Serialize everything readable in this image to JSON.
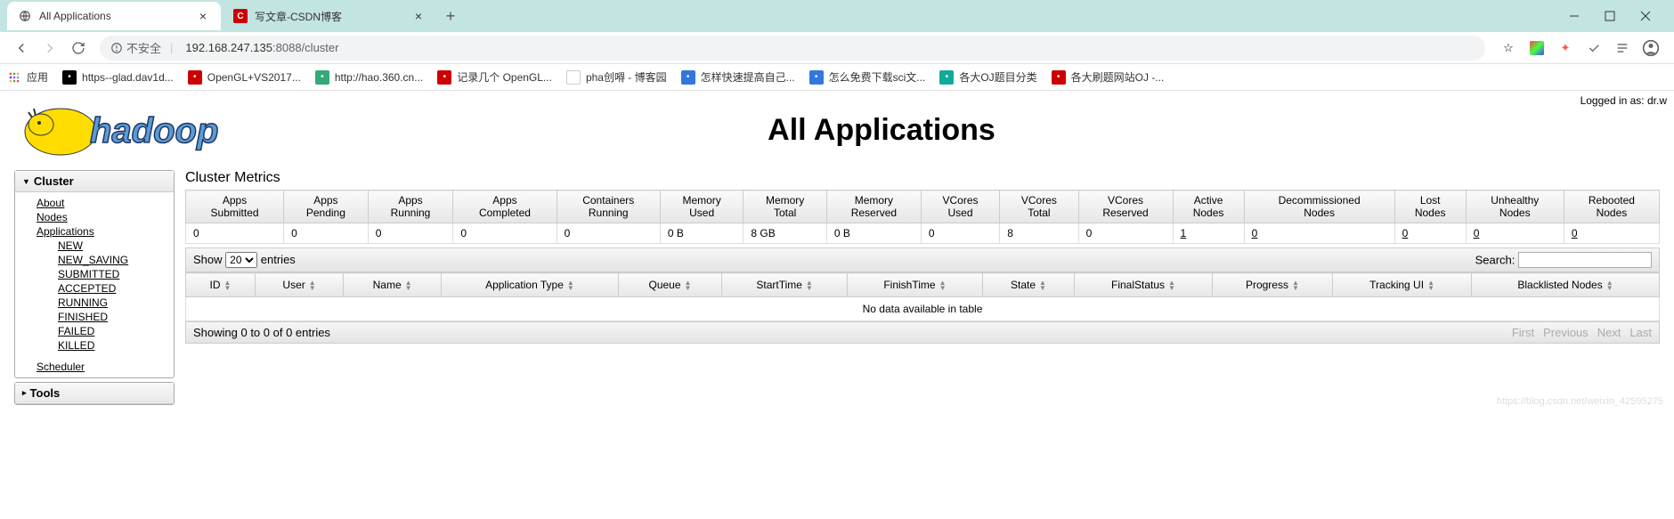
{
  "browser": {
    "tabs": [
      {
        "title": "All Applications",
        "active": true
      },
      {
        "title": "写文章-CSDN博客",
        "active": false
      }
    ],
    "insecure_label": "不安全",
    "url_host": "192.168.247.135",
    "url_port": ":8088",
    "url_path": "/cluster",
    "bookmarks_apps_label": "应用",
    "bookmarks": [
      {
        "label": "https--glad.dav1d...",
        "bg": "#000"
      },
      {
        "label": "OpenGL+VS2017...",
        "bg": "#c00"
      },
      {
        "label": "http://hao.360.cn...",
        "bg": "#3a7"
      },
      {
        "label": "记录几个 OpenGL...",
        "bg": "#c00"
      },
      {
        "label": "pha创嘚 - 博客园",
        "bg": "#fff"
      },
      {
        "label": "怎样快速提高自己...",
        "bg": "#37d"
      },
      {
        "label": "怎么免费下载sci文...",
        "bg": "#37d"
      },
      {
        "label": "各大OJ题目分类",
        "bg": "#1a9"
      },
      {
        "label": "各大刷题网站OJ -...",
        "bg": "#c00"
      }
    ]
  },
  "page": {
    "title": "All Applications",
    "logged_in_prefix": "Logged in as: ",
    "logged_in_user": "dr.w",
    "watermark": "https://blog.csdn.net/weixin_42595275"
  },
  "sidebar": {
    "cluster_header": "Cluster",
    "tools_header": "Tools",
    "links": {
      "about": "About",
      "nodes": "Nodes",
      "applications": "Applications",
      "scheduler": "Scheduler"
    },
    "app_states": [
      "NEW",
      "NEW_SAVING",
      "SUBMITTED",
      "ACCEPTED",
      "RUNNING",
      "FINISHED",
      "FAILED",
      "KILLED"
    ]
  },
  "metrics": {
    "section_title": "Cluster Metrics",
    "headers": [
      "Apps Submitted",
      "Apps Pending",
      "Apps Running",
      "Apps Completed",
      "Containers Running",
      "Memory Used",
      "Memory Total",
      "Memory Reserved",
      "VCores Used",
      "VCores Total",
      "VCores Reserved",
      "Active Nodes",
      "Decommissioned Nodes",
      "Lost Nodes",
      "Unhealthy Nodes",
      "Rebooted Nodes"
    ],
    "values": [
      "0",
      "0",
      "0",
      "0",
      "0",
      "0 B",
      "8 GB",
      "0 B",
      "0",
      "8",
      "0",
      "1",
      "0",
      "0",
      "0",
      "0"
    ],
    "linked_indices": [
      11,
      12,
      13,
      14,
      15
    ]
  },
  "datatable": {
    "show_label": "Show",
    "entries_label": "entries",
    "show_value": "20",
    "search_label": "Search:",
    "headers": [
      "ID",
      "User",
      "Name",
      "Application Type",
      "Queue",
      "StartTime",
      "FinishTime",
      "State",
      "FinalStatus",
      "Progress",
      "Tracking UI",
      "Blacklisted Nodes"
    ],
    "empty_message": "No data available in table",
    "info": "Showing 0 to 0 of 0 entries",
    "pager": {
      "first": "First",
      "prev": "Previous",
      "next": "Next",
      "last": "Last"
    }
  }
}
